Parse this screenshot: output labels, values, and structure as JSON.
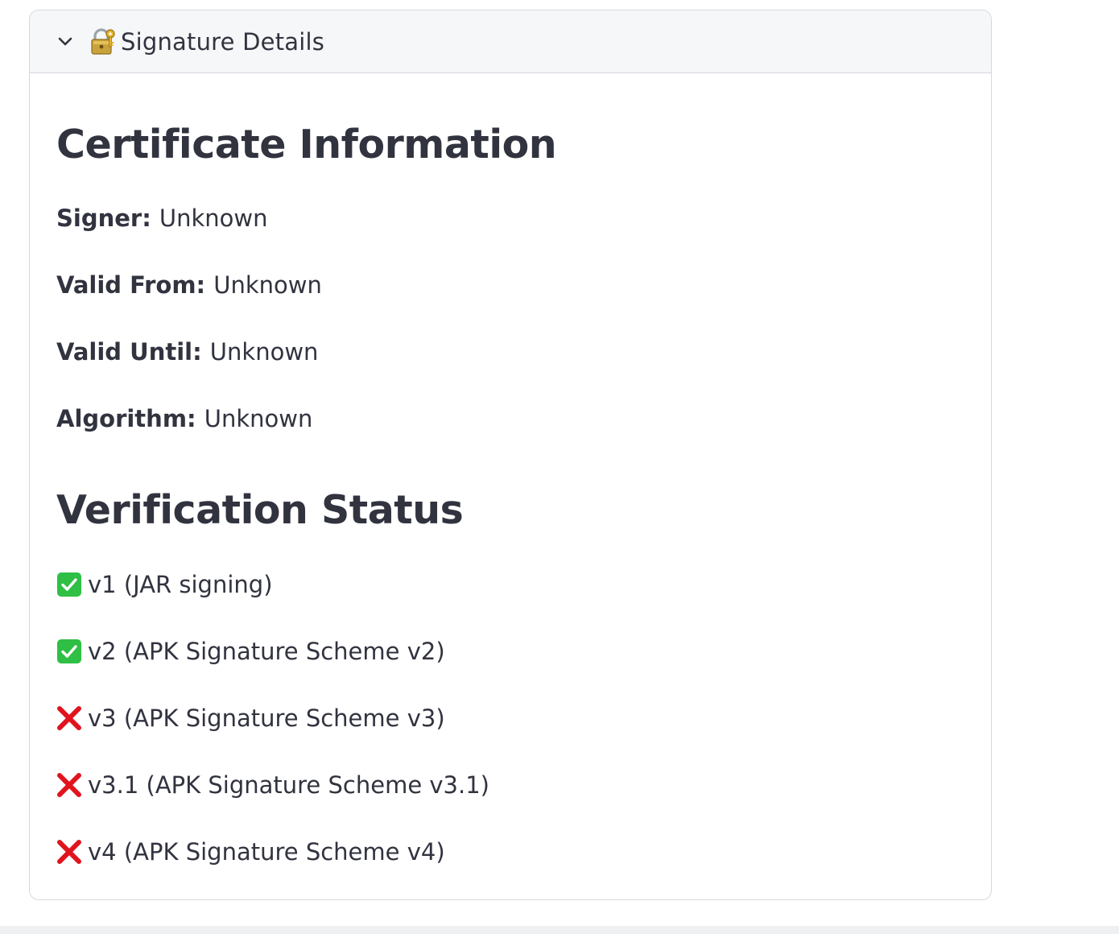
{
  "expander": {
    "title": "Signature Details",
    "icons": {
      "toggle": "chevron-down-icon",
      "title": "locked-with-key-icon"
    }
  },
  "certificate": {
    "heading": "Certificate Information",
    "fields": [
      {
        "label": "Signer:",
        "value": "Unknown"
      },
      {
        "label": "Valid From:",
        "value": "Unknown"
      },
      {
        "label": "Valid Until:",
        "value": "Unknown"
      },
      {
        "label": "Algorithm:",
        "value": "Unknown"
      }
    ]
  },
  "verification": {
    "heading": "Verification Status",
    "items": [
      {
        "status": "pass",
        "icon": "check-mark-icon",
        "text": "v1 (JAR signing)"
      },
      {
        "status": "pass",
        "icon": "check-mark-icon",
        "text": "v2 (APK Signature Scheme v2)"
      },
      {
        "status": "fail",
        "icon": "cross-mark-icon",
        "text": "v3 (APK Signature Scheme v3)"
      },
      {
        "status": "fail",
        "icon": "cross-mark-icon",
        "text": "v3.1 (APK Signature Scheme v3.1)"
      },
      {
        "status": "fail",
        "icon": "cross-mark-icon",
        "text": "v4 (APK Signature Scheme v4)"
      }
    ]
  },
  "colors": {
    "text": "#31333f",
    "border": "#d6d8de",
    "header_bg": "#f6f7f9",
    "pass": "#2fbf45",
    "fail": "#e0141e"
  }
}
